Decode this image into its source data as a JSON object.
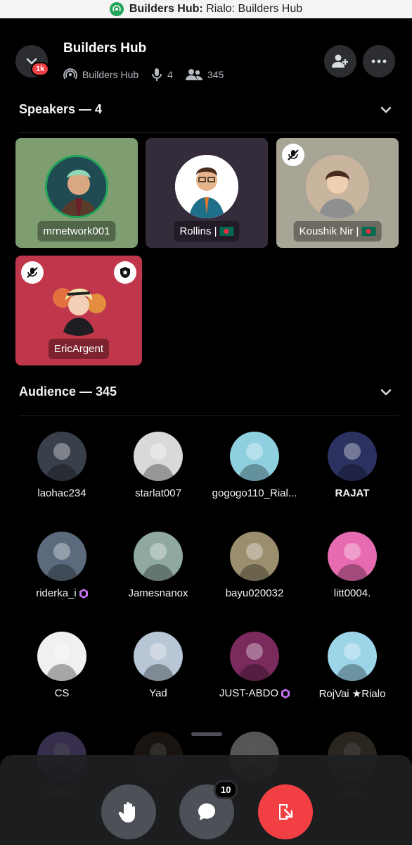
{
  "browser": {
    "bold_title": "Builders Hub:",
    "title_rest": "Rialo: Builders Hub"
  },
  "header": {
    "title": "Builders Hub",
    "server": "Builders Hub",
    "speakers_count": "4",
    "listeners_count": "345",
    "unread_badge": "1k",
    "icons": [
      "chevron-down-icon",
      "stage-icon",
      "microphone-icon",
      "people-icon",
      "add-user-icon",
      "more-icon"
    ]
  },
  "speakers_section": {
    "title": "Speakers — 4"
  },
  "speakers": [
    {
      "name": "mrnetwork001",
      "bg": "#7e9e71",
      "flag": false,
      "muted": false,
      "moderator": false
    },
    {
      "name": "Rollins |",
      "bg": "#342b3b",
      "flag": true,
      "muted": false,
      "moderator": false
    },
    {
      "name": "Koushik Nir |",
      "bg": "#a8a496",
      "flag": true,
      "muted": true,
      "moderator": false
    },
    {
      "name": "EricArgent",
      "bg": "#c0364a",
      "flag": false,
      "muted": true,
      "moderator": true
    }
  ],
  "audience_section": {
    "title": "Audience — 345"
  },
  "audience": [
    {
      "name": "laohac234",
      "color": "#3a3f4c",
      "nitro": false,
      "bold": false
    },
    {
      "name": "starlat007",
      "color": "#d9d9d9",
      "nitro": false,
      "bold": false
    },
    {
      "name": "gogogo110_Rial...",
      "color": "#8fd0e0",
      "nitro": false,
      "bold": false
    },
    {
      "name": "RAJAT",
      "color": "#2c3260",
      "nitro": false,
      "bold": true
    },
    {
      "name": "riderka_i",
      "color": "#5b6b7d",
      "nitro": true,
      "bold": false
    },
    {
      "name": "Jamesnanox",
      "color": "#8fa8a0",
      "nitro": false,
      "bold": false
    },
    {
      "name": "bayu020032",
      "color": "#9a8e6e",
      "nitro": false,
      "bold": false
    },
    {
      "name": "litt0004.",
      "color": "#e76bb0",
      "nitro": false,
      "bold": false
    },
    {
      "name": "CS",
      "color": "#f0f0f0",
      "nitro": false,
      "bold": false
    },
    {
      "name": "Yad",
      "color": "#b8c6d6",
      "nitro": false,
      "bold": false
    },
    {
      "name": "JUST-ABDO",
      "color": "#7a2a5c",
      "nitro": true,
      "bold": false
    },
    {
      "name": "RojVai ★Rialo",
      "color": "#9cd4e8",
      "nitro": false,
      "bold": false
    },
    {
      "name": "hellmc7",
      "color": "#9b84d8",
      "nitro": false,
      "bold": false
    },
    {
      "name": "...",
      "color": "#4a3a30",
      "nitro": false,
      "bold": false
    },
    {
      "name": "...",
      "color": "#f4f4f4",
      "nitro": false,
      "bold": false
    },
    {
      "name": "...Joe...",
      "color": "#7a6a58",
      "nitro": false,
      "bold": false
    }
  ],
  "controls": {
    "chat_badge": "10",
    "icons": [
      "raise-hand-icon",
      "chat-icon",
      "leave-stage-icon"
    ],
    "colors": {
      "neutral": "#4e5058",
      "leave": "#f23f43"
    }
  }
}
